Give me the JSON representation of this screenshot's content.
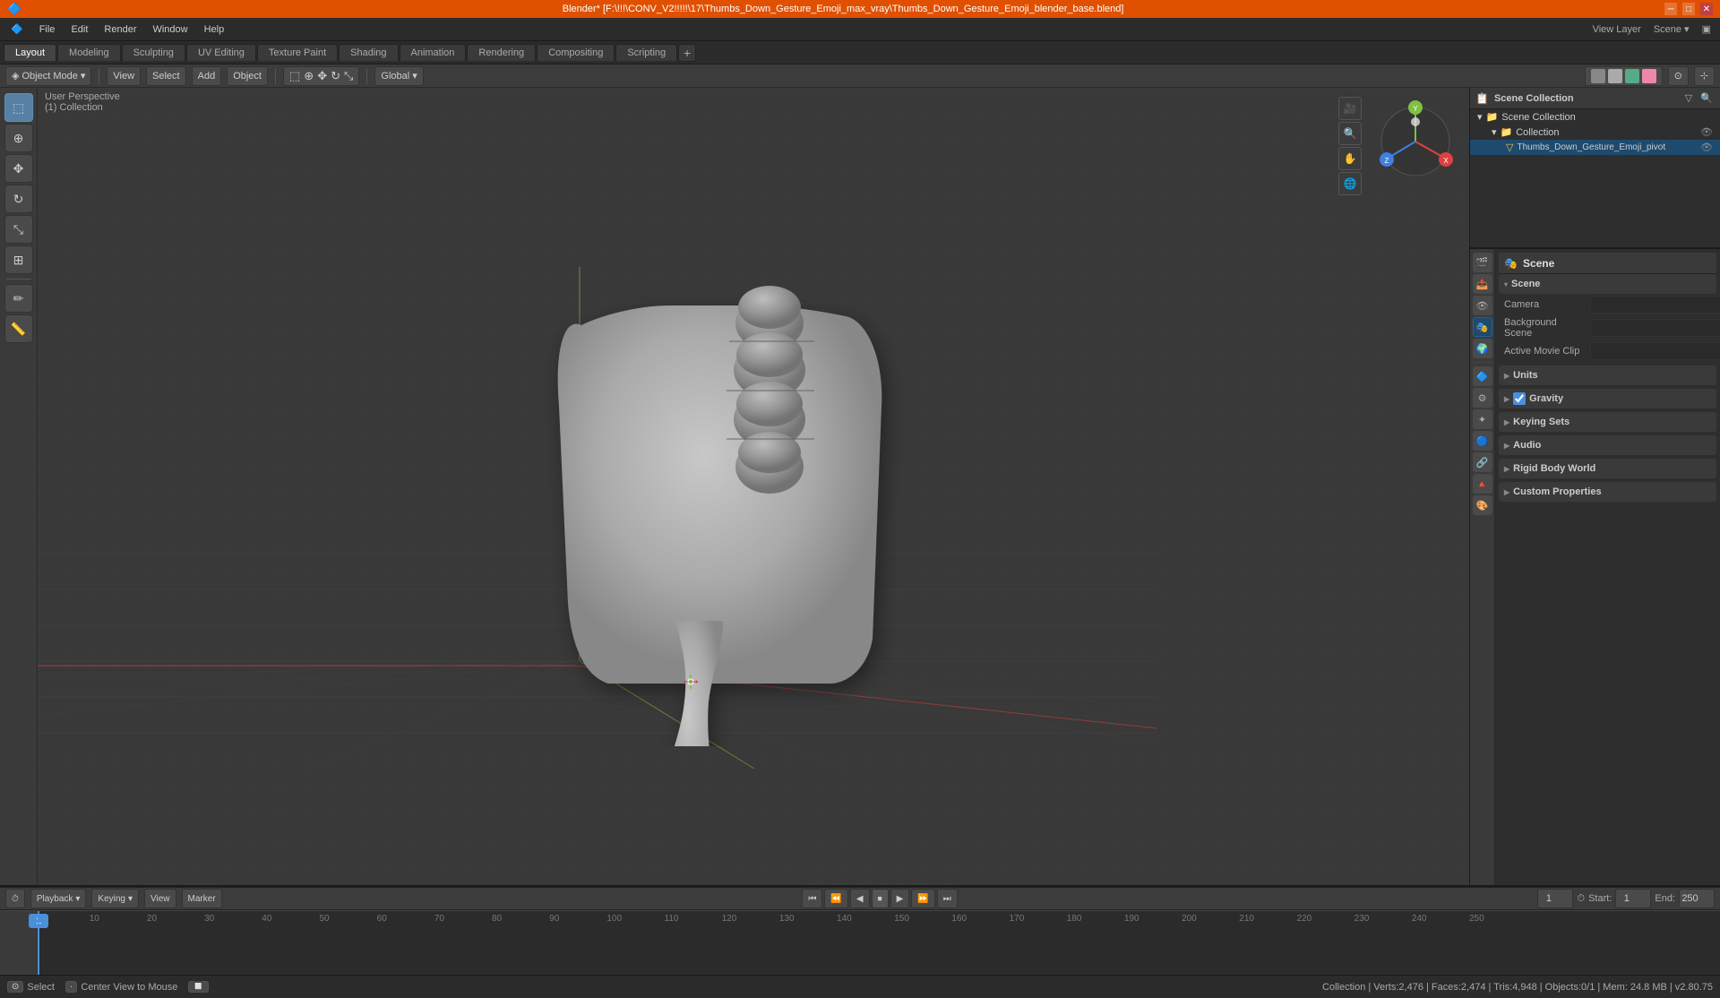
{
  "window": {
    "title": "Blender* [F:\\!!!\\CONV_V2!!!!!\\17\\Thumbs_Down_Gesture_Emoji_max_vray\\Thumbs_Down_Gesture_Emoji_blender_base.blend]"
  },
  "menus": [
    "Blender",
    "File",
    "Edit",
    "Render",
    "Window",
    "Help"
  ],
  "workspace_tabs": [
    {
      "label": "Layout",
      "active": true
    },
    {
      "label": "Modeling",
      "active": false
    },
    {
      "label": "Sculpting",
      "active": false
    },
    {
      "label": "UV Editing",
      "active": false
    },
    {
      "label": "Texture Paint",
      "active": false
    },
    {
      "label": "Shading",
      "active": false
    },
    {
      "label": "Animation",
      "active": false
    },
    {
      "label": "Rendering",
      "active": false
    },
    {
      "label": "Compositing",
      "active": false
    },
    {
      "label": "Scripting",
      "active": false
    }
  ],
  "header": {
    "object_mode": "Object Mode",
    "view": "View",
    "select": "Select",
    "add": "Add",
    "object": "Object",
    "transform": "Global",
    "proportional": "Off"
  },
  "viewport": {
    "view_label": "User Perspective",
    "collection": "(1) Collection"
  },
  "timeline": {
    "playback": "Playback",
    "keying": "Keying",
    "view": "View",
    "marker": "Marker",
    "frame_current": "1",
    "start": "1",
    "end": "250",
    "frame_numbers": [
      1,
      10,
      20,
      30,
      40,
      50,
      60,
      70,
      80,
      90,
      100,
      110,
      120,
      130,
      140,
      150,
      160,
      170,
      180,
      190,
      200,
      210,
      220,
      230,
      240,
      250
    ]
  },
  "statusbar": {
    "left_key": "⊙",
    "left_action": "Select",
    "mid_key": "·",
    "mid_action": "Center View to Mouse",
    "right_action": "Collection | Verts:2,476 | Faces:2,474 | Tris:4,948 | Objects:0/1 | Mem: 24.8 MB | v2.80.75"
  },
  "outliner": {
    "title": "Scene Collection",
    "items": [
      {
        "name": "Scene Collection",
        "icon": "📁",
        "indent": 0,
        "expanded": true
      },
      {
        "name": "Collection",
        "icon": "📁",
        "indent": 1,
        "expanded": true
      },
      {
        "name": "Thumbs_Down_Gesture_Emoji_pivot",
        "icon": "▽",
        "indent": 2,
        "expanded": false
      }
    ]
  },
  "properties": {
    "title": "Scene",
    "icon": "🎬",
    "sections": [
      {
        "name": "Scene",
        "rows": [
          {
            "label": "Camera",
            "value": "",
            "type": "field"
          },
          {
            "label": "Background Scene",
            "value": "",
            "type": "field"
          },
          {
            "label": "Active Movie Clip",
            "value": "",
            "type": "field"
          }
        ]
      },
      {
        "name": "Units",
        "rows": [],
        "collapsed": true
      },
      {
        "name": "Gravity",
        "rows": [],
        "collapsed": true,
        "checkbox": true
      },
      {
        "name": "Keying Sets",
        "rows": [],
        "collapsed": true
      },
      {
        "name": "Audio",
        "rows": [],
        "collapsed": true
      },
      {
        "name": "Rigid Body World",
        "rows": [],
        "collapsed": true
      },
      {
        "name": "Custom Properties",
        "rows": [],
        "collapsed": true
      }
    ]
  },
  "prop_icons": [
    {
      "icon": "🎬",
      "name": "render",
      "title": "Render"
    },
    {
      "icon": "📤",
      "name": "output",
      "title": "Output"
    },
    {
      "icon": "👁",
      "name": "view-layer",
      "title": "View Layer"
    },
    {
      "icon": "🎭",
      "name": "scene",
      "title": "Scene",
      "active": true
    },
    {
      "icon": "🌍",
      "name": "world",
      "title": "World"
    },
    {
      "icon": "🔧",
      "name": "object",
      "title": "Object"
    },
    {
      "icon": "⚙",
      "name": "modifiers",
      "title": "Modifiers"
    },
    {
      "icon": "📦",
      "name": "particles",
      "title": "Particles"
    },
    {
      "icon": "🔵",
      "name": "physics",
      "title": "Physics"
    },
    {
      "icon": "📐",
      "name": "constraints",
      "title": "Constraints"
    },
    {
      "icon": "🔺",
      "name": "data",
      "title": "Object Data"
    },
    {
      "icon": "🎨",
      "name": "material",
      "title": "Material"
    }
  ],
  "tools": [
    {
      "icon": "↔",
      "name": "select-box",
      "title": "Select Box",
      "active": true
    },
    {
      "icon": "✥",
      "name": "move",
      "title": "Move"
    },
    {
      "icon": "↻",
      "name": "rotate",
      "title": "Rotate"
    },
    {
      "icon": "⤡",
      "name": "scale",
      "title": "Scale"
    },
    {
      "icon": "⊞",
      "name": "transform",
      "title": "Transform"
    },
    {
      "sep": true
    },
    {
      "icon": "🖊",
      "name": "annotate",
      "title": "Annotate"
    },
    {
      "icon": "📏",
      "name": "measure",
      "title": "Measure"
    }
  ]
}
